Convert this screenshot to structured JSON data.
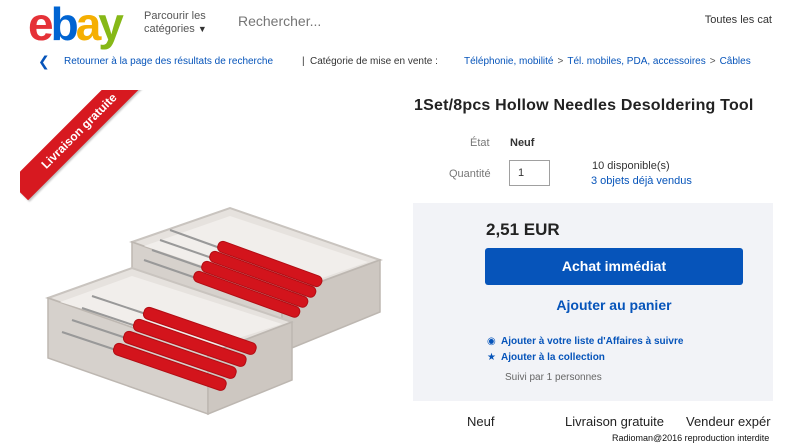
{
  "header": {
    "logo_letters": [
      "e",
      "b",
      "a",
      "y"
    ],
    "logo_colors": [
      "#e53238",
      "#0064d2",
      "#f5af02",
      "#86b817"
    ],
    "browse_line1": "Parcourir les",
    "browse_line2": "catégories",
    "search_placeholder": "Rechercher...",
    "all_categories": "Toutes les cat"
  },
  "breadcrumb": {
    "back_link": "Retourner à la page des résultats de recherche",
    "separator": "|",
    "category_label": "Catégorie de mise en vente :",
    "trail": [
      "Téléphonie, mobilité",
      "Tél. mobiles, PDA, accessoires",
      "Câbles"
    ]
  },
  "image": {
    "ribbon_text": "Livraison gratuite",
    "ribbon_color": "#d71920"
  },
  "product": {
    "title": "1Set/8pcs Hollow Needles Desoldering Tool",
    "etat_label": "État",
    "etat_value": "Neuf",
    "quantity_label": "Quantité",
    "quantity_value": "1",
    "available": "10 disponible(s)",
    "sold": "3 objets déjà vendus"
  },
  "buybox": {
    "price": "2,51 EUR",
    "buy_now": "Achat immédiat",
    "add_to_cart": "Ajouter au panier",
    "watch_list": "Ajouter à votre liste d'Affaires à suivre",
    "add_collection": "Ajouter à la collection",
    "followers": "Suivi par 1 personnes",
    "accent_color": "#0654ba"
  },
  "bottom": {
    "condition": "Neuf",
    "shipping": "Livraison gratuite",
    "seller": "Vendeur expér"
  },
  "watermark": "Radioman@2016 reproduction interdite"
}
